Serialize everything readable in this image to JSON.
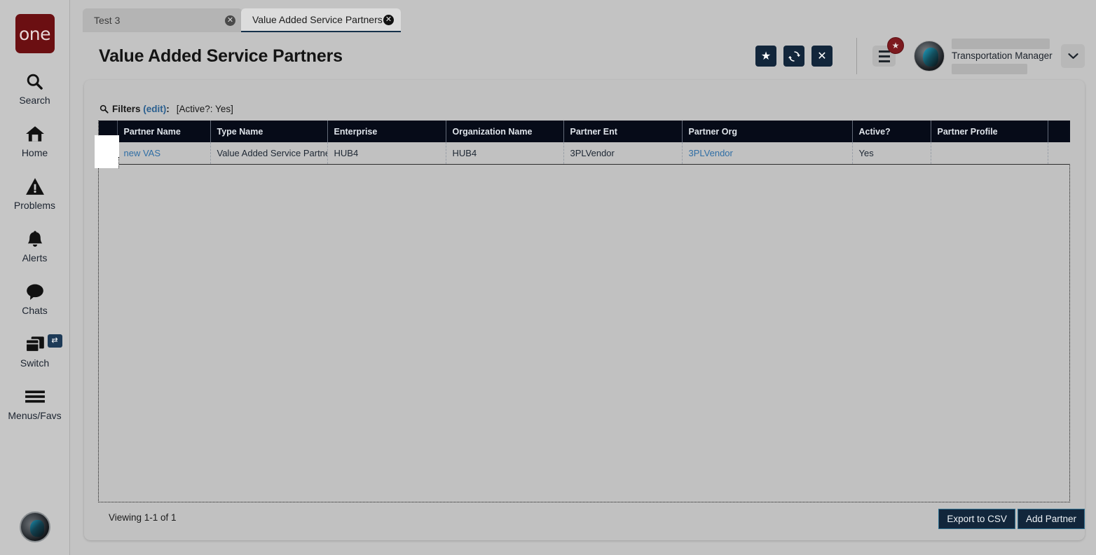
{
  "brand": {
    "logo_text": "one"
  },
  "sidebar": {
    "items": [
      {
        "label": "Search",
        "icon": "search-icon"
      },
      {
        "label": "Home",
        "icon": "home-icon"
      },
      {
        "label": "Problems",
        "icon": "warning-triangle-icon"
      },
      {
        "label": "Alerts",
        "icon": "bell-icon"
      },
      {
        "label": "Chats",
        "icon": "chat-bubble-icon"
      },
      {
        "label": "Switch",
        "icon": "windows-stack-icon",
        "badge_icon": "swap-arrows-icon"
      },
      {
        "label": "Menus/Favs",
        "icon": "hamburger-icon"
      }
    ]
  },
  "tabs": [
    {
      "label": "Test 3",
      "active": false,
      "close_icon": "close-circle-icon"
    },
    {
      "label": "Value Added Service Partners",
      "active": true,
      "close_icon": "close-circle-icon"
    }
  ],
  "header": {
    "title": "Value Added Service Partners",
    "actions": [
      {
        "name": "favorite-button",
        "icon": "star-icon",
        "glyph": "★"
      },
      {
        "name": "refresh-button",
        "icon": "refresh-icon",
        "glyph": "↻"
      },
      {
        "name": "close-button",
        "icon": "close-icon",
        "glyph": "✕"
      }
    ],
    "menu_button": {
      "icon": "hamburger-icon",
      "badge_icon": "star-icon",
      "badge_glyph": "★"
    },
    "user": {
      "avatar_icon": "user-avatar-icon",
      "name_redacted": true,
      "role": "Transportation Manager",
      "detail_redacted": true,
      "caret_icon": "chevron-down-icon",
      "caret_glyph": "⌄"
    }
  },
  "filters": {
    "icon": "search-icon",
    "label": "Filters",
    "edit_label": "(edit)",
    "colon": ":",
    "value": "[Active?: Yes]"
  },
  "grid": {
    "columns": [
      {
        "key": "sel",
        "label": ""
      },
      {
        "key": "partner_name",
        "label": "Partner Name"
      },
      {
        "key": "type_name",
        "label": "Type Name"
      },
      {
        "key": "enterprise",
        "label": "Enterprise"
      },
      {
        "key": "organization_name",
        "label": "Organization Name"
      },
      {
        "key": "partner_ent",
        "label": "Partner Ent"
      },
      {
        "key": "partner_org",
        "label": "Partner Org"
      },
      {
        "key": "active",
        "label": "Active?"
      },
      {
        "key": "partner_profile",
        "label": "Partner Profile"
      },
      {
        "key": "spacer",
        "label": ""
      }
    ],
    "rows": [
      {
        "remove_glyph": "✖",
        "partner_name": "new VAS",
        "type_name": "Value Added Service Partner",
        "enterprise": "HUB4",
        "organization_name": "HUB4",
        "partner_ent": "3PLVendor",
        "partner_org": "3PLVendor",
        "active": "Yes",
        "partner_profile": "",
        "spacer": ""
      }
    ]
  },
  "footer": {
    "viewing": "Viewing 1-1 of 1",
    "export_label": "Export to CSV",
    "add_label": "Add Partner"
  },
  "colors": {
    "brand_red": "#6b0f12",
    "header_dark": "#060b18",
    "button_navy": "#12263b",
    "link_blue": "#2f6ea5",
    "page_bg": "#c3c3c3",
    "badge_red": "#7c1a1f"
  }
}
